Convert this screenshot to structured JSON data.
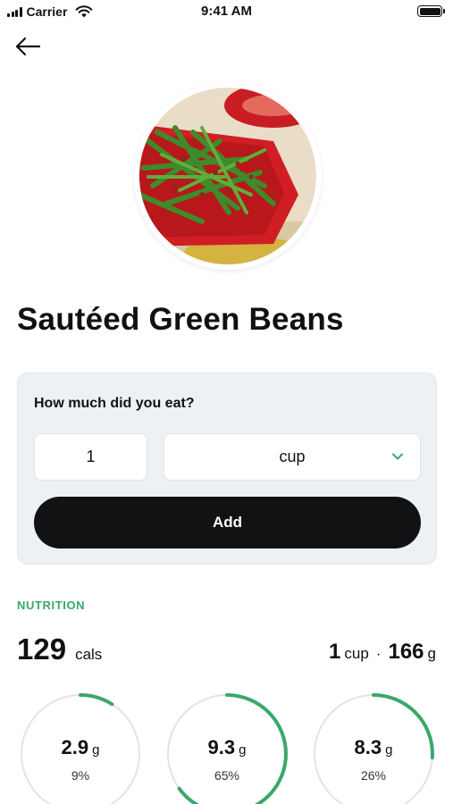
{
  "status_bar": {
    "carrier": "Carrier",
    "time": "9:41 AM"
  },
  "food": {
    "title": "Sautéed Green Beans"
  },
  "portion": {
    "question": "How much did you eat?",
    "quantity": "1",
    "unit": "cup",
    "add_label": "Add"
  },
  "nutrition": {
    "section_label": "NUTRITION",
    "calories": "129",
    "calories_unit": "cals",
    "serving_qty": "1",
    "serving_unit": "cup",
    "separator": "·",
    "serving_weight": "166",
    "weight_unit": "g",
    "macros": [
      {
        "value": "2.9",
        "unit": "g",
        "percent_label": "9%",
        "percent": 9
      },
      {
        "value": "9.3",
        "unit": "g",
        "percent_label": "65%",
        "percent": 65
      },
      {
        "value": "8.3",
        "unit": "g",
        "percent_label": "26%",
        "percent": 26
      }
    ]
  },
  "colors": {
    "accent_green": "#3aa86a",
    "ring_track": "#e3e3e3",
    "button_dark": "#111214",
    "card_background": "#eef1f4"
  },
  "icons": {
    "back": "arrow-left-icon",
    "dropdown": "chevron-down-icon",
    "wifi": "wifi-icon",
    "signal": "signal-icon",
    "battery": "battery-icon"
  }
}
